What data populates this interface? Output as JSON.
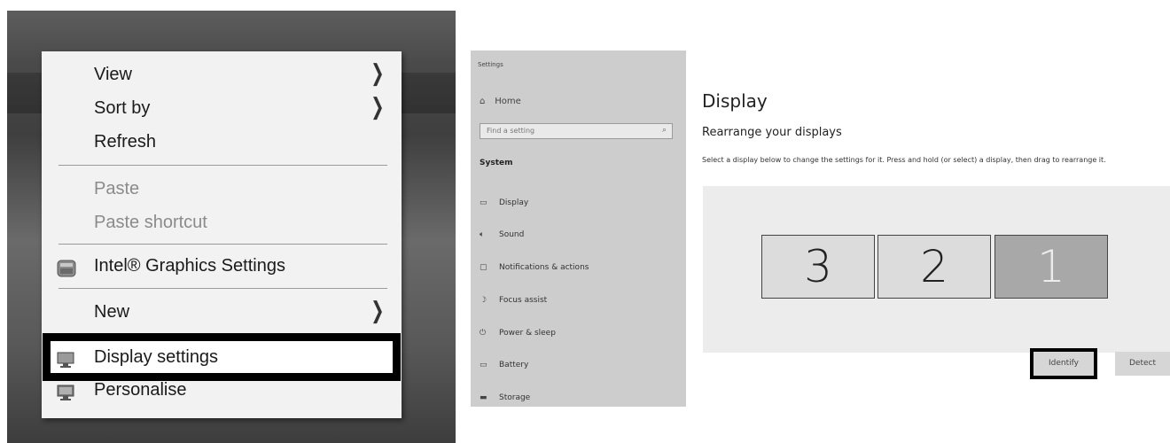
{
  "context_menu": {
    "view": "View",
    "sort_by": "Sort by",
    "refresh": "Refresh",
    "paste": "Paste",
    "paste_shortcut": "Paste shortcut",
    "intel_graphics": "Intel® Graphics Settings",
    "new": "New",
    "display_settings": "Display settings",
    "personalise": "Personalise"
  },
  "settings_sidebar": {
    "window_title": "Settings",
    "home": "Home",
    "search_placeholder": "Find a setting",
    "section": "System",
    "items": [
      "Display",
      "Sound",
      "Notifications & actions",
      "Focus assist",
      "Power & sleep",
      "Battery",
      "Storage"
    ]
  },
  "display_page": {
    "title": "Display",
    "subtitle": "Rearrange your displays",
    "description": "Select a display below to change the settings for it. Press and hold (or select) a display, then drag to rearrange it.",
    "monitors": [
      "3",
      "2",
      "1"
    ],
    "selected_monitor": "1",
    "identify_button": "Identify",
    "detect_button": "Detect"
  },
  "colors": {
    "highlight_border": "#000000",
    "menu_background": "#f2f2f2",
    "sidebar_background": "#cdcdcd"
  }
}
